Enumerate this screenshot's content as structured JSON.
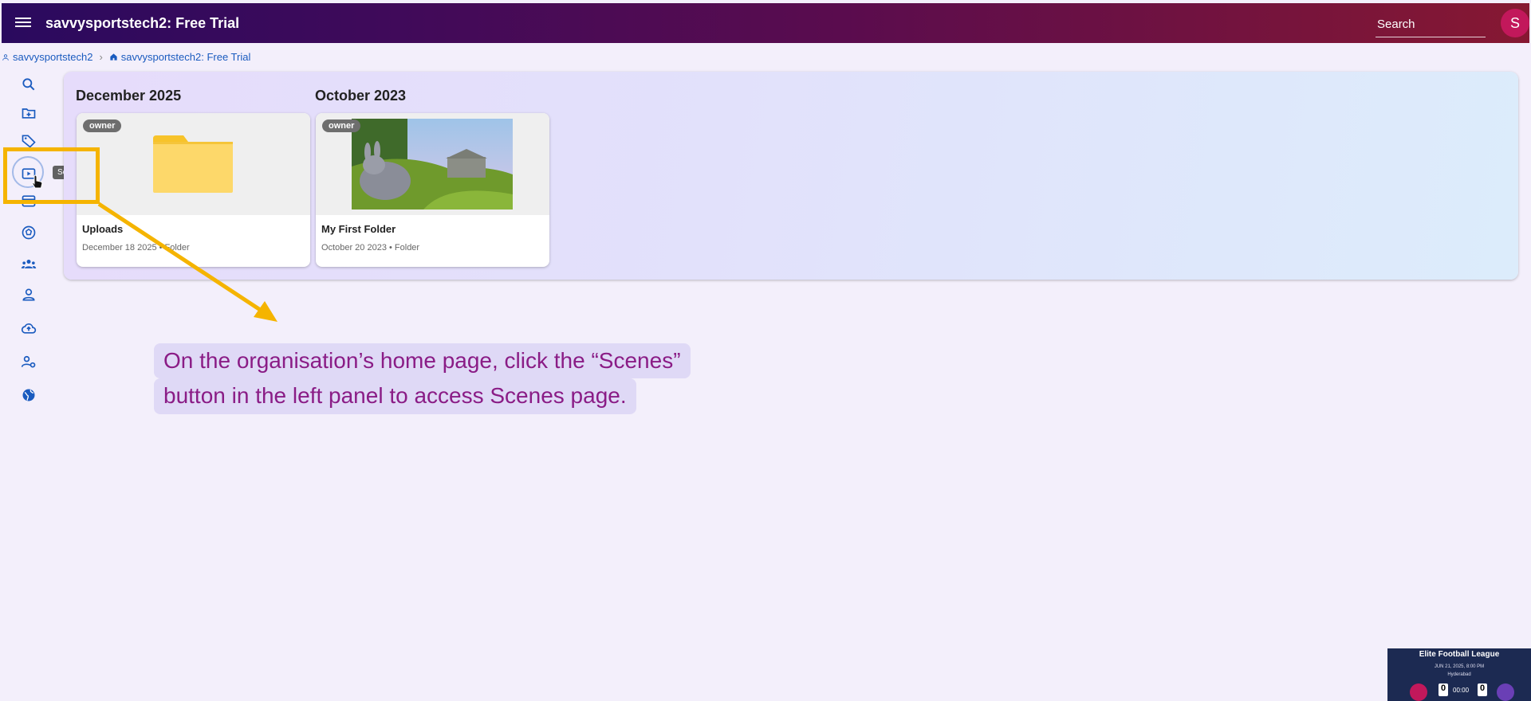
{
  "app": {
    "title": "savvysportstech2: Free Trial"
  },
  "search": {
    "placeholder": "Search"
  },
  "user": {
    "avatar_initial": "S"
  },
  "breadcrumb": [
    {
      "label": "savvysportstech2",
      "icon": "person-icon"
    },
    {
      "label": "savvysportstech2: Free Trial",
      "icon": "home-icon"
    }
  ],
  "sidebar": {
    "items": [
      {
        "name": "search",
        "icon": "search-icon"
      },
      {
        "name": "new-folder",
        "icon": "folder-add-icon"
      },
      {
        "name": "tags",
        "icon": "tag-icon"
      },
      {
        "name": "scenes",
        "icon": "scenes-icon",
        "tooltip": "Scenes",
        "active": true
      },
      {
        "name": "calendar",
        "icon": "calendar-icon"
      },
      {
        "name": "sports",
        "icon": "soccer-ball-icon"
      },
      {
        "name": "teams",
        "icon": "groups-icon"
      },
      {
        "name": "person",
        "icon": "person-icon"
      },
      {
        "name": "upload",
        "icon": "cloud-upload-icon"
      },
      {
        "name": "admin",
        "icon": "user-settings-icon"
      },
      {
        "name": "public",
        "icon": "globe-icon"
      }
    ]
  },
  "groups": [
    {
      "month": "December 2025",
      "cards": [
        {
          "badge": "owner",
          "name": "Uploads",
          "meta": "December 18 2025 • Folder",
          "thumb": "folder"
        }
      ]
    },
    {
      "month": "October 2023",
      "cards": [
        {
          "badge": "owner",
          "name": "My First Folder",
          "meta": "October 20 2023 • Folder",
          "thumb": "image"
        }
      ]
    }
  ],
  "instruction": {
    "line1": "On the organisation’s home page, click the “Scenes”",
    "line2": "button in the left panel to access Scenes page."
  },
  "video_thumb": {
    "title": "Elite Football League",
    "date": "JUN 21, 2025, 8:00 PM",
    "city": "Hyderabad",
    "score_a": "0",
    "score_b": "0",
    "clock": "00:00"
  },
  "colors": {
    "highlight": "#f5b400",
    "instruction_text": "#8a1c86",
    "nav_icon": "#1a5bbf",
    "avatar": "#c2185b"
  }
}
